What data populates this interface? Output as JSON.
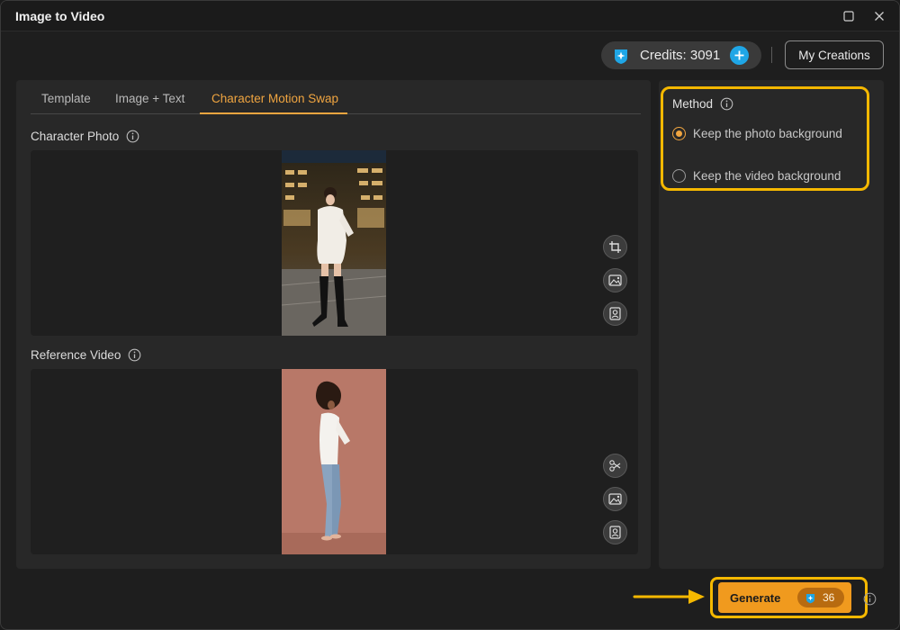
{
  "window": {
    "title": "Image to Video"
  },
  "header": {
    "credits_label": "Credits: 3091",
    "my_creations_label": "My Creations"
  },
  "tabs": [
    {
      "label": "Template",
      "active": false
    },
    {
      "label": "Image + Text",
      "active": false
    },
    {
      "label": "Character Motion Swap",
      "active": true
    }
  ],
  "character_photo": {
    "label": "Character Photo"
  },
  "reference_video": {
    "label": "Reference Video"
  },
  "method": {
    "title": "Method",
    "options": [
      {
        "label": "Keep the photo background",
        "selected": true
      },
      {
        "label": "Keep the video background",
        "selected": false
      }
    ]
  },
  "generate": {
    "label": "Generate",
    "cost": "36"
  },
  "colors": {
    "accent": "#f0a540",
    "highlight": "#f5b800",
    "credits_plus": "#1fa6e6",
    "generate": "#f09a1e"
  },
  "icons": {
    "credits": "gem-icon",
    "add_credits": "plus-icon",
    "info": "info-icon",
    "crop": "crop-icon",
    "replace_image": "replace-image-icon",
    "portrait": "portrait-icon",
    "trim_video": "scissors-icon"
  }
}
